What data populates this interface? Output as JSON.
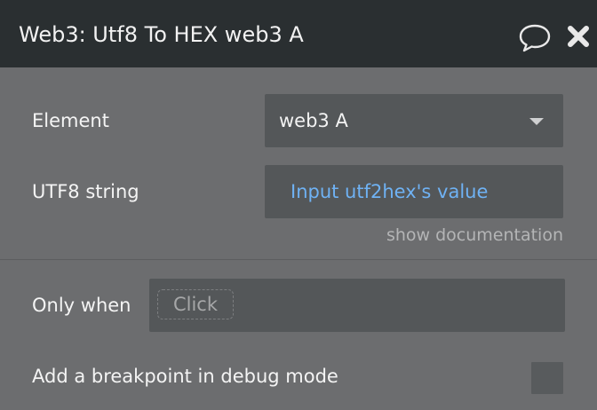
{
  "header": {
    "title": "Web3: Utf8 To HEX web3 A",
    "icons": [
      "comment-icon",
      "close-icon"
    ]
  },
  "fields": {
    "element": {
      "label": "Element",
      "value": "web3 A"
    },
    "utf8_string": {
      "label": "UTF8 string",
      "value": "Input utf2hex's value"
    }
  },
  "show_documentation": "show documentation",
  "condition": {
    "label": "Only when",
    "placeholder": "Click"
  },
  "breakpoint": {
    "label": "Add a breakpoint in debug mode",
    "checked": false
  },
  "colors": {
    "header_bg": "#2a2f31",
    "panel_bg": "#6c6d6f",
    "field_bg": "#545759",
    "dynamic_value": "#6fb2f4"
  }
}
